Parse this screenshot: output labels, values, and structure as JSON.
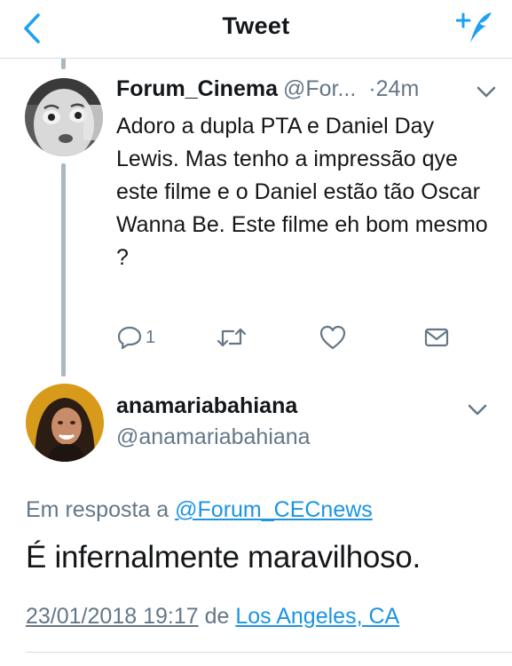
{
  "navbar": {
    "title": "Tweet",
    "back_icon": "chevron-left-icon",
    "compose_icon": "compose-tweet-icon",
    "accent": "#1da1f2"
  },
  "parent_tweet": {
    "name": "Forum_Cinema",
    "handle": "@For...",
    "time": "·24m",
    "text": "Adoro a dupla PTA e Daniel Day Lewis. Mas tenho a impressão qye este filme e o Daniel estão tão Oscar Wanna Be.  Este filme eh bom mesmo ?",
    "reply_count": "1",
    "actions": [
      "reply-icon",
      "retweet-icon",
      "like-icon",
      "direct-message-icon"
    ]
  },
  "focused_tweet": {
    "name": "anamariabahiana",
    "handle": "@anamariabahiana",
    "reply_to_prefix": "Em resposta a",
    "reply_to_handle": "@Forum_CECnews",
    "text": "É infernalmente maravilhoso.",
    "date": "23/01/2018 19:17",
    "location_prefix": "de",
    "location": "Los Angeles, CA"
  },
  "colors": {
    "text": "#14171a",
    "secondary": "#657786",
    "link": "#1b95e0",
    "thread_line": "#aab8c2",
    "divider": "#d8dee3"
  }
}
